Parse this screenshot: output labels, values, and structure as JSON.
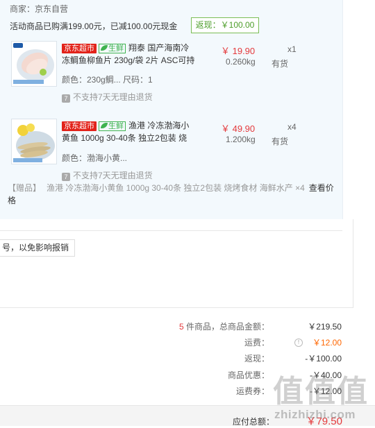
{
  "merchant": {
    "label": "商家：京东自营"
  },
  "promo": {
    "line": "活动商品已购满199.00元，已减100.00元现金",
    "tag": "返现：￥100.00"
  },
  "items": [
    {
      "tag_jd": "京东超市",
      "tag_fresh": "生鲜",
      "title": "翔泰 国产海南冷冻鲷鱼柳鱼片 230g/袋 2片 ASC可持",
      "price": "￥ 19.90",
      "qty": "x1",
      "weight": "0.260kg",
      "stock": "有货",
      "attrs": "颜色：230g鲷...   尺码：1",
      "no_return": "不支持7天无理由退货",
      "no_return_icon": "7"
    },
    {
      "tag_jd": "京东超市",
      "tag_fresh": "生鲜",
      "title": "渔港 冷冻渤海小黄鱼 1000g 30-40条 独立2包装 烧",
      "price": "￥ 49.90",
      "qty": "x4",
      "weight": "1.200kg",
      "stock": "有货",
      "attrs": "颜色：渤海小黄...",
      "no_return": "不支持7天无理由退货",
      "no_return_icon": "7"
    }
  ],
  "gift": {
    "tag": "【赠品】",
    "name": "渔港 冷冻渤海小黄鱼 1000g 30-40条 独立2包装 烧烤食材 海鲜水产 ×4",
    "link": "查看价格"
  },
  "tip": {
    "text": "号，以免影响报销"
  },
  "summary": {
    "count_num": "5",
    "count_label": "件商品，总商品金额：",
    "total_goods": "￥219.50",
    "shipping_label": "运费：",
    "shipping_value": "￥12.00",
    "cashback_label": "返现：",
    "cashback_value": "-￥100.00",
    "discount_label": "商品优惠：",
    "discount_value": "-￥40.00",
    "shipping_coupon_label": "运费券：",
    "shipping_coupon_value": "-￥12.00",
    "payable_label": "应付总额：",
    "payable_value": "￥79.50"
  },
  "watermark": {
    "text": "值值值",
    "url": "zhizhizhi.com"
  },
  "colors": {
    "price_red": "#e4393c",
    "promo_green": "#4c9d29",
    "shipping_orange": "#ff6600"
  }
}
